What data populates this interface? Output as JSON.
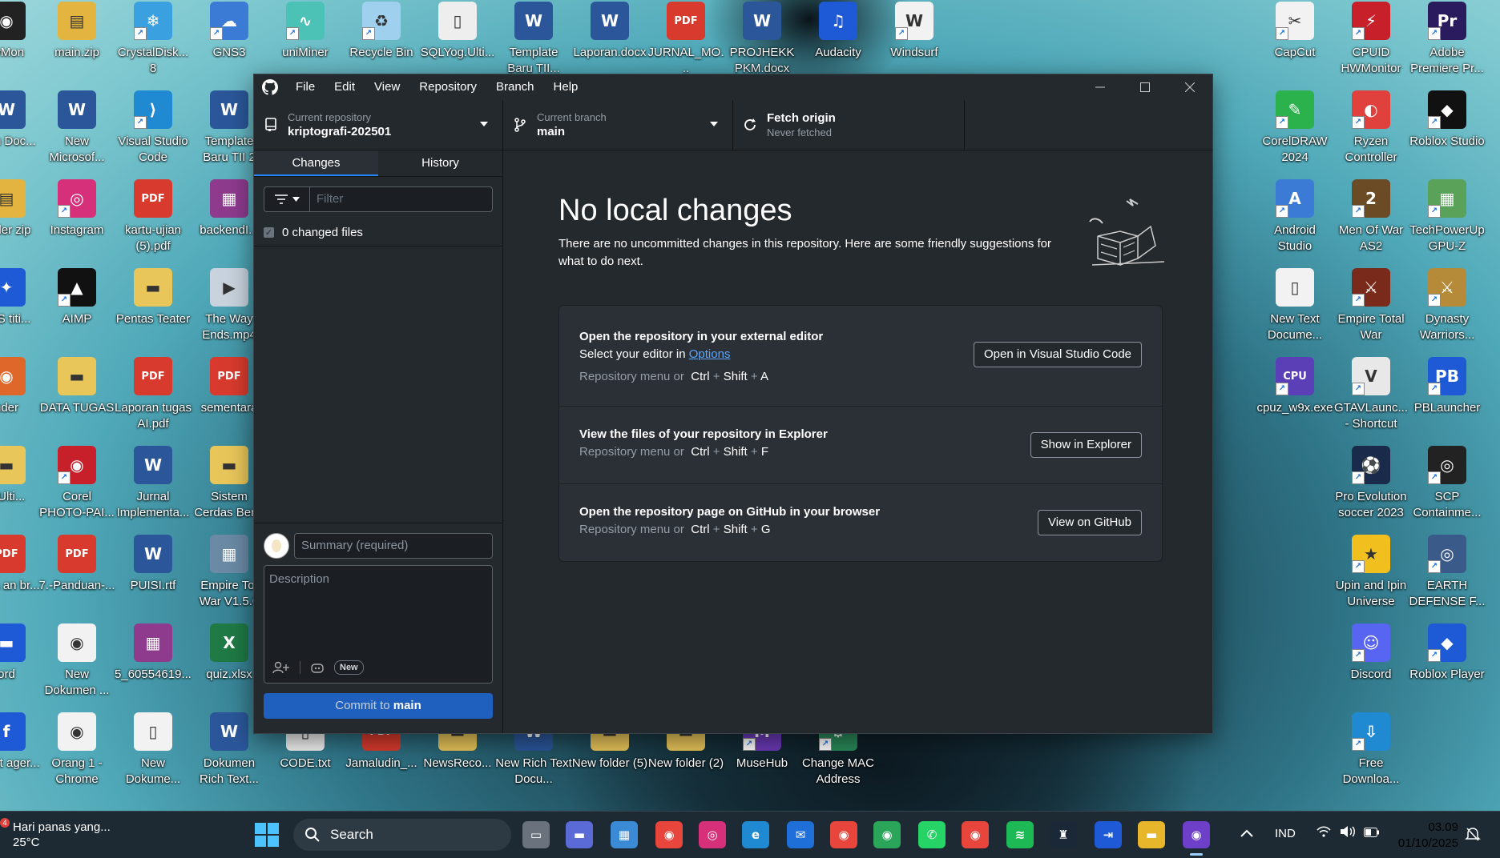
{
  "desktop": {
    "icons": [
      {
        "label": "cyMon",
        "color": "#222222",
        "glyph": "◉"
      },
      {
        "label": "main.zip",
        "color": "#e3b440",
        "glyph": "▤"
      },
      {
        "label": "CrystalDisk... 8",
        "color": "#3aa0e0",
        "glyph": "❄"
      },
      {
        "label": "GNS3",
        "color": "#3b7bd6",
        "glyph": "☁"
      },
      {
        "label": "uniMiner",
        "color": "#4cc1b6",
        "glyph": "∿"
      },
      {
        "label": "Recycle Bin",
        "color": "#9fd0ee",
        "glyph": "♻"
      },
      {
        "label": "SQLYog.Ulti...",
        "color": "#eeeeee",
        "glyph": "▯"
      },
      {
        "label": "Template Baru TII...",
        "color": "#2b579a",
        "glyph": "W"
      },
      {
        "label": "Laporan.docx",
        "color": "#2b579a",
        "glyph": "W"
      },
      {
        "label": "JURNAL_MO...",
        "color": "#d83b2e",
        "glyph": "PDF"
      },
      {
        "label": "PROJHEKK PKM.docx",
        "color": "#2b579a",
        "glyph": "W"
      },
      {
        "label": "Audacity",
        "color": "#1f5ad6",
        "glyph": "♫"
      },
      {
        "label": "Windsurf",
        "color": "#f2f2f2",
        "glyph": "W"
      },
      {
        "label": "CapCut",
        "color": "#f2f2f2",
        "glyph": "✂"
      },
      {
        "label": "CPUID HWMonitor",
        "color": "#c8202a",
        "glyph": "⚡"
      },
      {
        "label": "Adobe Premiere Pr...",
        "color": "#2a1a5e",
        "glyph": "Pr"
      },
      {
        "label": "Rich Doc...",
        "color": "#2b579a",
        "glyph": "W"
      },
      {
        "label": "New Microsof...",
        "color": "#2b579a",
        "glyph": "W"
      },
      {
        "label": "Visual Studio Code",
        "color": "#1f8ad2",
        "glyph": "⟩"
      },
      {
        "label": "Template Baru TII 2",
        "color": "#2b579a",
        "glyph": "W"
      },
      {
        "label": "CorelDRAW 2024",
        "color": "#2bb24c",
        "glyph": "✎"
      },
      {
        "label": "Ryzen Controller",
        "color": "#e0413c",
        "glyph": "◐"
      },
      {
        "label": "Roblox Studio",
        "color": "#111111",
        "glyph": "◆"
      },
      {
        "label": "folder zip",
        "color": "#e3b440",
        "glyph": "▤"
      },
      {
        "label": "Instagram",
        "color": "#d6307b",
        "glyph": "◎"
      },
      {
        "label": "kartu-ujian (5).pdf",
        "color": "#d83b2e",
        "glyph": "PDF"
      },
      {
        "label": "backendI...",
        "color": "#8e3b8e",
        "glyph": "▦"
      },
      {
        "label": "Android Studio",
        "color": "#3b7bd6",
        "glyph": "A"
      },
      {
        "label": "Men Of War AS2",
        "color": "#6b4a26",
        "glyph": "2"
      },
      {
        "label": "TechPowerUp GPU-Z",
        "color": "#5aa25a",
        "glyph": "▦"
      },
      {
        "label": "eUS titi...",
        "color": "#1f5ad6",
        "glyph": "✦"
      },
      {
        "label": "AIMP",
        "color": "#111111",
        "glyph": "▲"
      },
      {
        "label": "Pentas Teater",
        "color": "#e8c65a",
        "glyph": "▬"
      },
      {
        "label": "The Way Ends.mp4",
        "color": "#c9d3de",
        "glyph": "▶"
      },
      {
        "label": "New Text Docume...",
        "color": "#f2f2f2",
        "glyph": "▯"
      },
      {
        "label": "Empire Total War",
        "color": "#7a2a1a",
        "glyph": "⚔"
      },
      {
        "label": "Dynasty Warriors...",
        "color": "#b58b3a",
        "glyph": "⚔"
      },
      {
        "label": "nder",
        "color": "#e0672a",
        "glyph": "◉"
      },
      {
        "label": "DATA TUGAS",
        "color": "#e8c65a",
        "glyph": "▬"
      },
      {
        "label": "Laporan tugas AI.pdf",
        "color": "#d83b2e",
        "glyph": "PDF"
      },
      {
        "label": "sementara",
        "color": "#d83b2e",
        "glyph": "PDF"
      },
      {
        "label": "cpuz_w9x.exe",
        "color": "#5b3fb6",
        "glyph": "CPU"
      },
      {
        "label": "GTAVLaunc... - Shortcut",
        "color": "#e8e8e8",
        "glyph": "V"
      },
      {
        "label": "PBLauncher",
        "color": "#1f5ad6",
        "glyph": "PB"
      },
      {
        "label": "g.Ulti...",
        "color": "#e8c65a",
        "glyph": "▬"
      },
      {
        "label": "Corel PHOTO-PAI...",
        "color": "#c8202a",
        "glyph": "◉"
      },
      {
        "label": "Jurnal Implementa...",
        "color": "#2b579a",
        "glyph": "W"
      },
      {
        "label": "Sistem Cerdas Ber...",
        "color": "#e8c65a",
        "glyph": "▬"
      },
      {
        "label": "Pro Evolution soccer 2023",
        "color": "#1a2a4a",
        "glyph": "⚽"
      },
      {
        "label": "SCP Containme...",
        "color": "#222222",
        "glyph": "◎"
      },
      {
        "label": "ritma an br...",
        "color": "#d83b2e",
        "glyph": "PDF"
      },
      {
        "label": "7.-Panduan-...",
        "color": "#d83b2e",
        "glyph": "PDF"
      },
      {
        "label": "PUISI.rtf",
        "color": "#2b579a",
        "glyph": "W"
      },
      {
        "label": "Empire Tot War V1.5.0",
        "color": "#6a8aa5",
        "glyph": "▦"
      },
      {
        "label": "Upin and Ipin Universe",
        "color": "#f2c01e",
        "glyph": "★"
      },
      {
        "label": "EARTH DEFENSE F...",
        "color": "#3a5a8a",
        "glyph": "◎"
      },
      {
        "label": "ord",
        "color": "#1f5ad6",
        "glyph": "▬"
      },
      {
        "label": "New Dokumen ...",
        "color": "#f2f2f2",
        "glyph": "◉"
      },
      {
        "label": "5_60554619...",
        "color": "#8e3b8e",
        "glyph": "▦"
      },
      {
        "label": "quiz.xlsx",
        "color": "#1f7a45",
        "glyph": "X"
      },
      {
        "label": "Discord",
        "color": "#5865f2",
        "glyph": "☺"
      },
      {
        "label": "Roblox Player",
        "color": "#1f5ad6",
        "glyph": "◆"
      },
      {
        "label": "l Font ager...",
        "color": "#1f5ad6",
        "glyph": "f"
      },
      {
        "label": "Orang 1 - Chrome",
        "color": "#f2f2f2",
        "glyph": "◉"
      },
      {
        "label": "New Dokume...",
        "color": "#f2f2f2",
        "glyph": "▯"
      },
      {
        "label": "Dokumen Rich Text...",
        "color": "#2b579a",
        "glyph": "W"
      },
      {
        "label": "CODE.txt",
        "color": "#f2f2f2",
        "glyph": "▯"
      },
      {
        "label": "Jamaludin_...",
        "color": "#d83b2e",
        "glyph": "PDF"
      },
      {
        "label": "NewsReco...",
        "color": "#e8c65a",
        "glyph": "▬"
      },
      {
        "label": "New Rich Text Docu...",
        "color": "#2b579a",
        "glyph": "W"
      },
      {
        "label": "New folder (5)",
        "color": "#e8c65a",
        "glyph": "▬"
      },
      {
        "label": "New folder (2)",
        "color": "#e8c65a",
        "glyph": "▬"
      },
      {
        "label": "MuseHub",
        "color": "#6a3ab6",
        "glyph": "M"
      },
      {
        "label": "Change MAC Address",
        "color": "#2a8a5a",
        "glyph": "⚙"
      },
      {
        "label": "Free Downloa...",
        "color": "#1f8ad2",
        "glyph": "⇩"
      }
    ]
  },
  "app": {
    "menu": [
      "File",
      "Edit",
      "View",
      "Repository",
      "Branch",
      "Help"
    ],
    "toolbar": {
      "repo_label": "Current repository",
      "repo_value": "kriptografi-202501",
      "branch_label": "Current branch",
      "branch_value": "main",
      "fetch_label": "Fetch origin",
      "fetch_sub": "Never fetched"
    },
    "tabs": {
      "changes": "Changes",
      "history": "History"
    },
    "filter_placeholder": "Filter",
    "changed_files": "0 changed files",
    "summary_placeholder": "Summary (required)",
    "description_placeholder": "Description",
    "new_badge": "New",
    "commit": {
      "prefix": "Commit to ",
      "branch": "main"
    },
    "main": {
      "title": "No local changes",
      "subtitle": "There are no uncommitted changes in this repository. Here are some friendly suggestions for what to do next."
    },
    "cards": {
      "editor": {
        "title": "Open the repository in your external editor",
        "line_prefix": "Select your editor in ",
        "line_link": "Options",
        "hint": "Repository menu or",
        "keys": [
          "Ctrl",
          "Shift",
          "A"
        ],
        "button": "Open in Visual Studio Code"
      },
      "explorer": {
        "title": "View the files of your repository in Explorer",
        "hint": "Repository menu or",
        "keys": [
          "Ctrl",
          "Shift",
          "F"
        ],
        "button": "Show in Explorer"
      },
      "github": {
        "title": "Open the repository page on GitHub in your browser",
        "hint": "Repository menu or",
        "keys": [
          "Ctrl",
          "Shift",
          "G"
        ],
        "button": "View on GitHub"
      }
    }
  },
  "taskbar": {
    "weather_text": "Hari panas yang...",
    "weather_temp": "25°C",
    "weather_badge": "4",
    "search": "Search",
    "apps": [
      {
        "name": "file-manager",
        "color": "#6a737d",
        "glyph": "▭"
      },
      {
        "name": "chat",
        "color": "#5a6ad6",
        "glyph": "▬"
      },
      {
        "name": "calendar",
        "color": "#3a8ad6",
        "glyph": "▦"
      },
      {
        "name": "chrome",
        "color": "#e8453c",
        "glyph": "◉"
      },
      {
        "name": "instagram",
        "color": "#d6307b",
        "glyph": "◎"
      },
      {
        "name": "edge",
        "color": "#1f8ad2",
        "glyph": "e"
      },
      {
        "name": "mail",
        "color": "#1f6fd9",
        "glyph": "✉"
      },
      {
        "name": "chrome-profile-1",
        "color": "#e8453c",
        "glyph": "◉"
      },
      {
        "name": "chrome-profile-2",
        "color": "#2aa55a",
        "glyph": "◉"
      },
      {
        "name": "whatsapp",
        "color": "#25d366",
        "glyph": "✆"
      },
      {
        "name": "chrome-profile-3",
        "color": "#e8453c",
        "glyph": "◉"
      },
      {
        "name": "spotify",
        "color": "#1db954",
        "glyph": "≋"
      },
      {
        "name": "steam",
        "color": "#1b2838",
        "glyph": "♜"
      },
      {
        "name": "app-launcher",
        "color": "#1f5ad6",
        "glyph": "⇥"
      },
      {
        "name": "file-explorer",
        "color": "#e8b62a",
        "glyph": "▬"
      },
      {
        "name": "github-desktop",
        "color": "#6e40c9",
        "glyph": "◉"
      }
    ],
    "lang": "IND",
    "time": "03.09",
    "date": "01/10/2025"
  }
}
